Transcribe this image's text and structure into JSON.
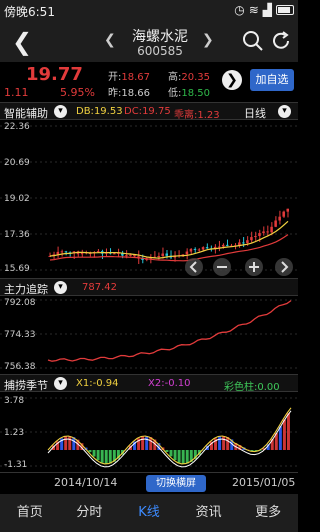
{
  "status": {
    "time": "傍晚6:51"
  },
  "header": {
    "title": "海螺水泥",
    "code": "600585",
    "back_icon": "‹"
  },
  "quote": {
    "price": "19.77",
    "change": "1.11",
    "percent": "5.95%",
    "open_label": "开:",
    "open": "18.67",
    "high_label": "高:",
    "high": "20.35",
    "prev_label": "昨:",
    "prev": "18.66",
    "low_label": "低:",
    "low": "18.50",
    "add_label": "加自选"
  },
  "kline": {
    "name": "智能辅助",
    "period": "日线",
    "db_label": "DB:",
    "db": "19.53",
    "dc_label": "DC:",
    "dc": "19.75",
    "deviation_label": "乖离:",
    "deviation": "1.23",
    "y_labels": [
      "22.36",
      "20.69",
      "19.02",
      "17.36",
      "15.69"
    ]
  },
  "trend": {
    "name": "主力追踪",
    "value": "787.42",
    "y_labels": [
      "792.08",
      "774.33",
      "756.38"
    ]
  },
  "season": {
    "name": "捕捞季节",
    "x1_label": "X1:",
    "x1": "-0.94",
    "x2_label": "X2:",
    "x2": "-0.10",
    "color_label": "彩色柱:",
    "color_val": "0.00",
    "y_labels": [
      "3.78",
      "1.23",
      "-1.31"
    ]
  },
  "dates": {
    "start": "2014/10/14",
    "end": "2015/01/05",
    "switch_label": "切换横屏"
  },
  "tabs": [
    "首页",
    "分时",
    "K线",
    "资讯",
    "更多"
  ],
  "colors": {
    "up": "#e23b3b",
    "down": "#2fb84a",
    "accent": "#2f67c9",
    "active_tab": "#3d8bff"
  }
}
